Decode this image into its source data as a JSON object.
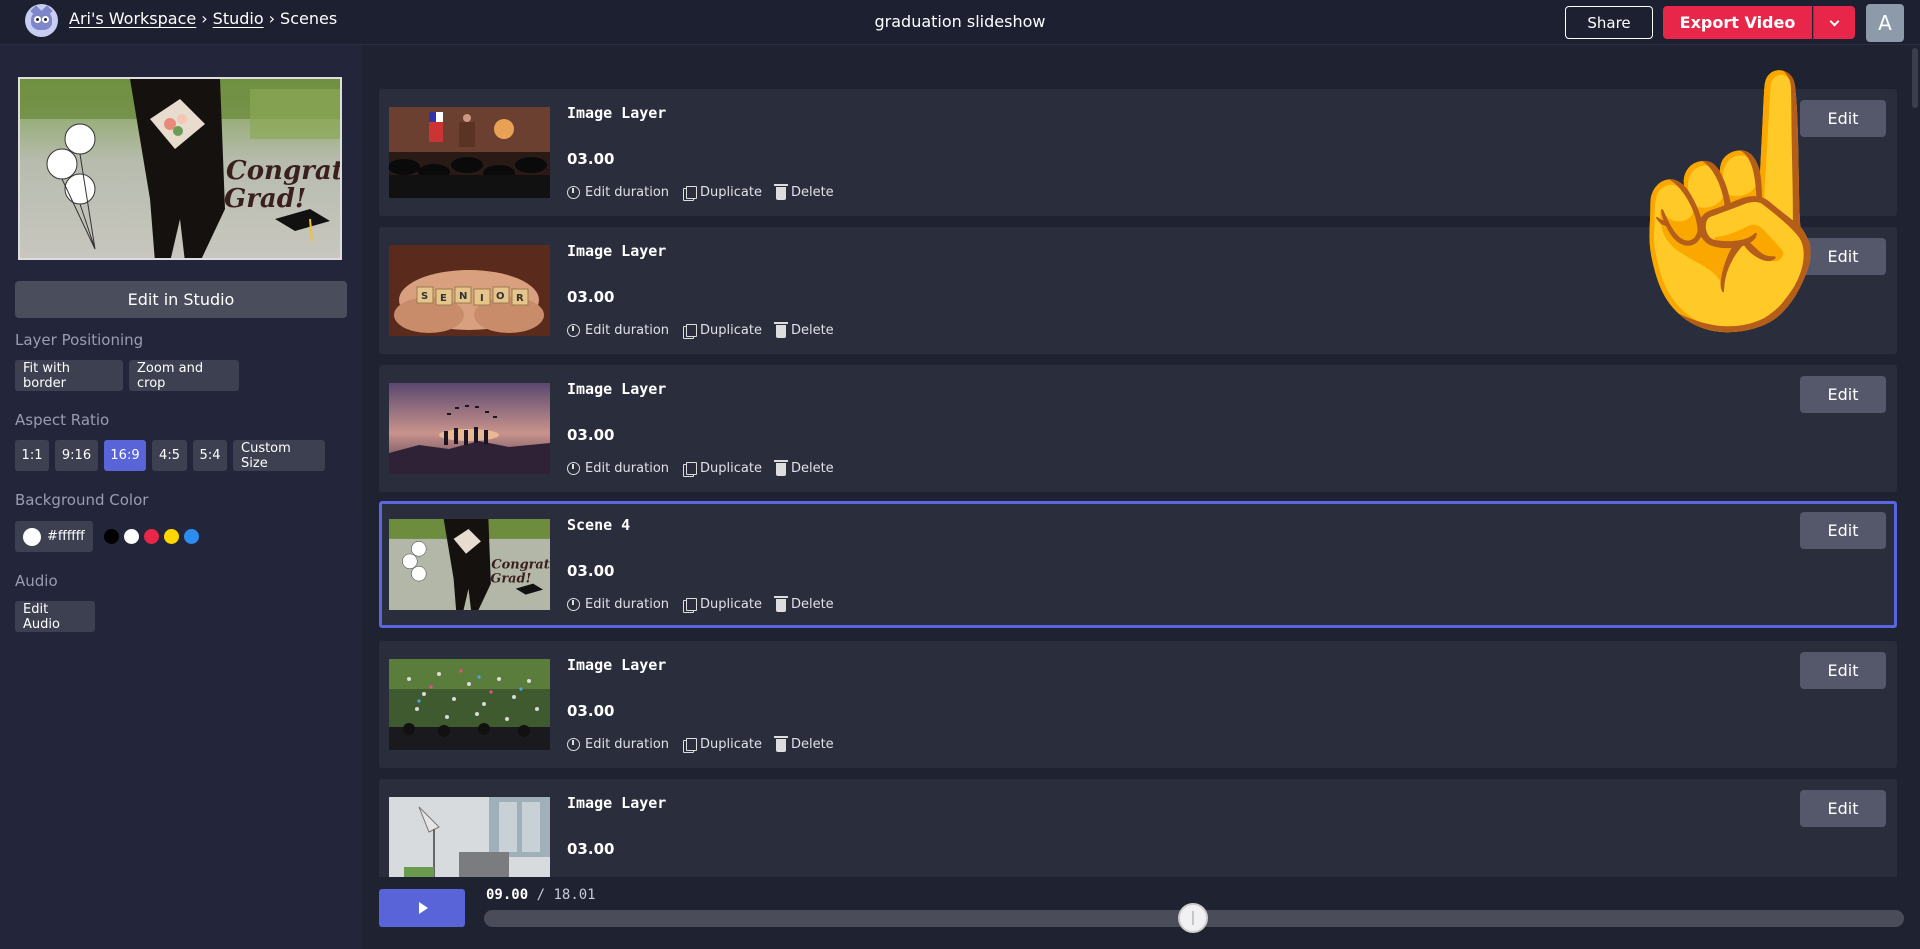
{
  "header": {
    "breadcrumb": {
      "workspace": "Ari's Workspace",
      "sep1": "›",
      "studio": "Studio",
      "sep2": "›",
      "current": "Scenes"
    },
    "title": "graduation slideshow",
    "share_label": "Share",
    "export_label": "Export Video",
    "avatar_initial": "A"
  },
  "sidebar": {
    "edit_in_studio": "Edit in Studio",
    "layer_positioning": {
      "label": "Layer Positioning",
      "options": [
        "Fit with border",
        "Zoom and crop"
      ]
    },
    "aspect_ratio": {
      "label": "Aspect Ratio",
      "options": [
        "1:1",
        "9:16",
        "16:9",
        "4:5",
        "5:4",
        "Custom Size"
      ],
      "selected": "16:9"
    },
    "background_color": {
      "label": "Background Color",
      "value": "#ffffff",
      "swatches": [
        "#000000",
        "#ffffff",
        "#e8264a",
        "#ffd600",
        "#2d8cf0"
      ]
    },
    "audio": {
      "label": "Audio",
      "edit_label": "Edit Audio"
    }
  },
  "scenes": [
    {
      "name": "Image Layer",
      "duration": "03.00",
      "thumb": "graduation ceremony"
    },
    {
      "name": "Image Layer",
      "duration": "03.00",
      "thumb": "senior tiles in hands"
    },
    {
      "name": "Image Layer",
      "duration": "03.00",
      "thumb": "caps at sunset"
    },
    {
      "name": "Scene 4",
      "duration": "03.00",
      "thumb": "congrats grad",
      "active": true
    },
    {
      "name": "Image Layer",
      "duration": "03.00",
      "thumb": "confetti celebration"
    },
    {
      "name": "Image Layer",
      "duration": "03.00",
      "thumb": "desk with laptop"
    }
  ],
  "scene_actions": {
    "edit_duration": "Edit duration",
    "duplicate": "Duplicate",
    "delete": "Delete",
    "edit": "Edit"
  },
  "playback": {
    "current": "09.00",
    "separator": "/",
    "total": "18.01"
  },
  "colors": {
    "accent": "#5864d8",
    "export": "#e8264a",
    "panel": "#23263a",
    "card": "#2a2d3b"
  }
}
